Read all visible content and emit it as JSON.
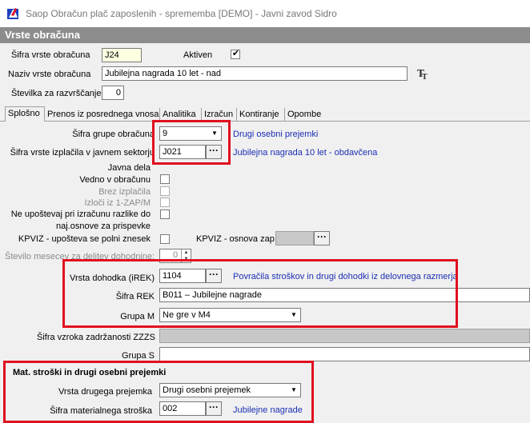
{
  "window": {
    "title": "Saop Obračun plač zaposlenih - sprememba [DEMO] - Javni zavod Sidro"
  },
  "form": {
    "header": "Vrste obračuna",
    "sifra_label": "Šifra vrste obračuna",
    "sifra_value": "J24",
    "aktiven_label": "Aktiven",
    "aktiven_checked": true,
    "naziv_label": "Naziv vrste obračuna",
    "naziv_value": "Jubilejna nagrada 10 let - nad",
    "stevilka_label": "Številka  za razvrščanje",
    "stevilka_value": "0"
  },
  "tabs": [
    "Splošno",
    "Prenos iz posrednega vnosa",
    "Analitika",
    "Izračun",
    "Kontiranje",
    "Opombe"
  ],
  "general": {
    "grupa_label": "Šifra grupe obračuna",
    "grupa_value": "9",
    "grupa_desc": "Drugi osebni prejemki",
    "izplacilo_label": "Šifra vrste izplačila v javnem sektorju",
    "izplacilo_value": "J021",
    "izplacilo_desc": "Jubilejna nagrada 10 let - obdavčena",
    "javna_dela_label": "Javna dela",
    "vedno_label": "Vedno v obračunu",
    "brez_label": "Brez izplačila",
    "izloci_label": "Izloči iz 1-ZAP/M",
    "neupostevaj_label1": "Ne upoštevaj pri izračunu razlike do",
    "neupostevaj_label2": "naj.osnove za prispevke",
    "kpviz_label": "KPVIZ - upošteva se polni znesek",
    "kpviz_osnova_label": "KPVIZ - osnova zap.",
    "mesecev_label": "Število mesecev za delitev dohodnine:",
    "mesecev_value": "0",
    "dohodek_label": "Vrsta dohodka (iREK)",
    "dohodek_value": "1104",
    "dohodek_desc": "Povračila stroškov in drugi dohodki iz delovnega razmerja",
    "rek_label": "Šifra REK",
    "rek_value": "B011 – Jubilejne nagrade",
    "grupa_m_label": "Grupa M",
    "grupa_m_value": "Ne gre v M4",
    "zzzs_label": "Šifra vzroka zadržanosti ZZZS",
    "grupa_s_label": "Grupa S",
    "mat_title": "Mat. stroški in drugi osebni prejemki",
    "drugi_prejemek_label": "Vrsta drugega prejemka",
    "drugi_prejemek_value": "Drugi osebni prejemek",
    "mat_strosek_label": "Šifra materialnega stroška",
    "mat_strosek_value": "002",
    "mat_strosek_desc": "Jubilejne nagrade"
  },
  "colors": {
    "accent_red": "#e0101f",
    "link_blue": "#1a2fb4",
    "header_gray": "#8c8c8c"
  }
}
